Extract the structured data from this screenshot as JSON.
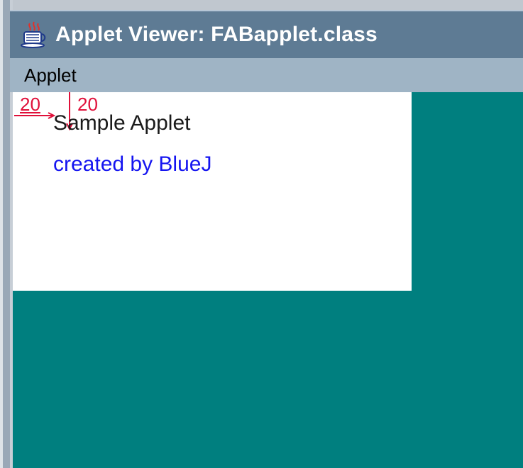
{
  "window": {
    "title": "Applet Viewer: FABapplet.class",
    "icon": "java-coffee-cup-icon"
  },
  "menu": {
    "items": [
      {
        "label": "Applet"
      }
    ]
  },
  "applet": {
    "line1": "Sample Applet",
    "line2": "created by BlueJ",
    "annotation_x": "20",
    "annotation_y": "20"
  },
  "colors": {
    "title_bar": "#5e7b94",
    "menu_bar": "#9fb4c5",
    "background": "#007f7f",
    "panel": "#ffffff",
    "annotation": "#e0103a",
    "link_text": "#1515f0"
  }
}
